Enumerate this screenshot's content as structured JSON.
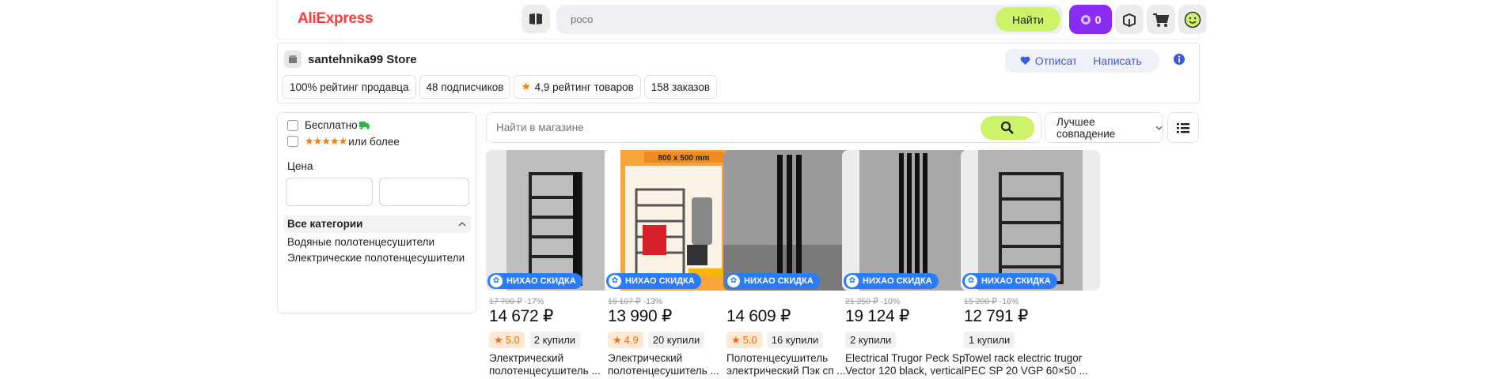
{
  "header": {
    "logo": "AliExpress",
    "search_placeholder": "росо",
    "search_button": "Найти",
    "coins": "0"
  },
  "store": {
    "name": "santehnika99 Store",
    "follow_label": "Отписаться",
    "message_label": "Написать",
    "stats": [
      {
        "text": "100% рейтинг продавца"
      },
      {
        "text": "48 подписчиков"
      },
      {
        "text": "4,9 рейтинг товаров"
      },
      {
        "text": "158 заказов"
      }
    ]
  },
  "filters": {
    "free_shipping": "Бесплатно",
    "rating_label": "или более",
    "price_label": "Цена",
    "categories_head": "Все категории",
    "categories": [
      "Водяные полотенцесушители",
      "Электрические полотенцесушители"
    ]
  },
  "main": {
    "search_placeholder": "Найти в магазине",
    "sort_label": "Лучшее совпадение"
  },
  "badge_text": "НИХАО СКИДКА",
  "products": [
    {
      "old": "17 700 ₽",
      "discount": "-17%",
      "price": "14 672 ₽",
      "rating": "5.0",
      "sold": "2 купили",
      "title": "Электрический полотенцесушитель ..."
    },
    {
      "old": "16 107 ₽",
      "discount": "-13%",
      "price": "13 990 ₽",
      "rating": "4.9",
      "sold": "20 купили",
      "title": "Электрический полотенцесушитель ..."
    },
    {
      "old": "",
      "discount": "",
      "price": "14 609 ₽",
      "rating": "5.0",
      "sold": "16 купили",
      "title": "Полотенцесушитель электрический Пэк сп ..."
    },
    {
      "old": "21 250 ₽",
      "discount": "-10%",
      "price": "19 124 ₽",
      "rating": "",
      "sold": "2 купили",
      "title": "Electrical Trugor Peck Sp Vector 120 black, vertical"
    },
    {
      "old": "15 200 ₽",
      "discount": "-16%",
      "price": "12 791 ₽",
      "rating": "",
      "sold": "1 купили",
      "title": "Towel rack electric trugor PEC SP 20 VGP 60×50 ..."
    }
  ],
  "product2_banner": "800 x 500 mm"
}
